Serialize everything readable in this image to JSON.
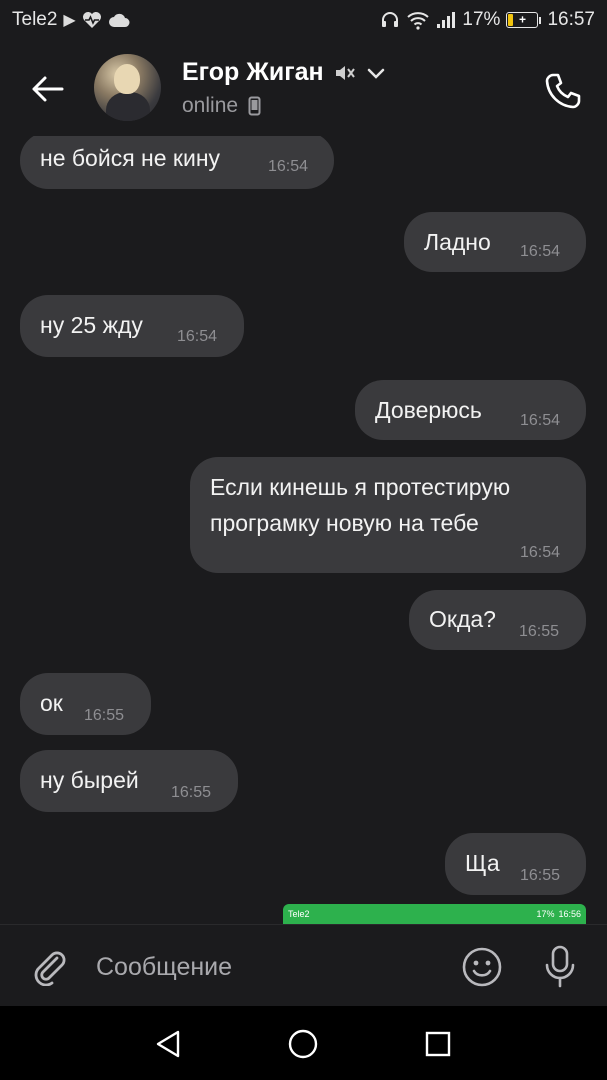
{
  "status_bar": {
    "carrier": "Tele2",
    "battery": "17%",
    "battery_level": 0.17,
    "time": "16:57"
  },
  "header": {
    "contact_name": "Егор Жиган",
    "contact_status": "online"
  },
  "messages": [
    {
      "text": "не бойся не кину",
      "time": "16:54",
      "side": "in"
    },
    {
      "text": "Ладно",
      "time": "16:54",
      "side": "out"
    },
    {
      "text": "ну 25 жду",
      "time": "16:54",
      "side": "in"
    },
    {
      "text": "Доверюсь",
      "time": "16:54",
      "side": "out"
    },
    {
      "text": "Если кинешь я протестирую програмку новую на тебе",
      "time": "16:54",
      "side": "out"
    },
    {
      "text": "Окда?",
      "time": "16:55",
      "side": "out"
    },
    {
      "text": "ок",
      "time": "16:55",
      "side": "in"
    },
    {
      "text": "ну бырей",
      "time": "16:55",
      "side": "in"
    },
    {
      "text": "Ща",
      "time": "16:55",
      "side": "out"
    }
  ],
  "image_preview": {
    "carrier": "Tele2",
    "battery": "17%",
    "time": "16:56"
  },
  "composer": {
    "placeholder": "Сообщение"
  },
  "colors": {
    "background": "#1b1b1d",
    "bubble": "#3a3a3d",
    "time_text": "#8e8e92",
    "preview_green": "#2db14d"
  },
  "icons": {
    "back": "arrow-left-icon",
    "muted": "speaker-muted-icon",
    "dropdown": "chevron-down-icon",
    "device": "phone-device-icon",
    "call": "phone-icon",
    "attach": "paperclip-icon",
    "emoji": "smiley-icon",
    "mic": "microphone-icon",
    "nav_back": "triangle-back-icon",
    "nav_home": "circle-home-icon",
    "nav_recents": "square-recents-icon"
  }
}
